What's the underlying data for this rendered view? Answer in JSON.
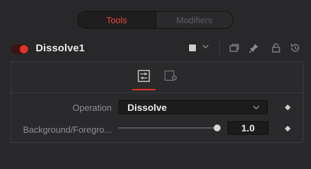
{
  "tabs": {
    "tools": "Tools",
    "modifiers": "Modifiers"
  },
  "header": {
    "node_name": "Dissolve1",
    "node_color": "#cfcfcf",
    "enabled": true
  },
  "accent": "#e3322b",
  "panel": {
    "operation": {
      "label": "Operation",
      "value": "Dissolve"
    },
    "background_foreground": {
      "label": "Background/Foregro...",
      "value": "1.0",
      "fraction": 1.0
    }
  }
}
